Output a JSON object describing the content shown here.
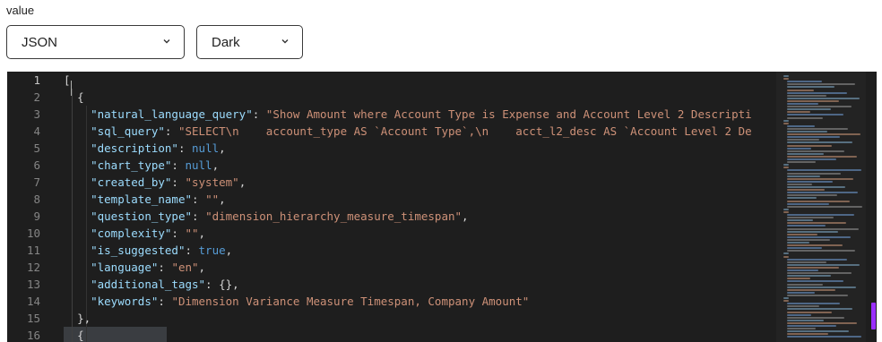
{
  "field": {
    "label": "value"
  },
  "format_select": {
    "value": "JSON",
    "icon": "chevron-down-icon"
  },
  "theme_select": {
    "value": "Dark",
    "icon": "chevron-down-icon"
  },
  "editor": {
    "theme": "dark",
    "colors": {
      "key": "#9cdcfe",
      "string": "#ce9178",
      "constant": "#569cd6",
      "punct": "#d4d4d4",
      "scroll_thumb": "#9b30ff"
    },
    "line_numbers": [
      "1",
      "2",
      "3",
      "4",
      "5",
      "6",
      "7",
      "8",
      "9",
      "10",
      "11",
      "12",
      "13",
      "14",
      "15",
      "16"
    ],
    "lines": [
      {
        "indent": "",
        "tokens": [
          [
            "p",
            "["
          ]
        ]
      },
      {
        "indent": "  ",
        "tokens": [
          [
            "p",
            "{"
          ]
        ]
      },
      {
        "indent": "    ",
        "tokens": [
          [
            "k",
            "\"natural_language_query\""
          ],
          [
            "p",
            ": "
          ],
          [
            "s",
            "\"Show Amount where Account Type is Expense and Account Level 2 Descripti"
          ]
        ]
      },
      {
        "indent": "    ",
        "tokens": [
          [
            "k",
            "\"sql_query\""
          ],
          [
            "p",
            ": "
          ],
          [
            "s",
            "\"SELECT\\n    account_type AS `Account Type`,\\n    acct_l2_desc AS `Account Level 2 De"
          ]
        ]
      },
      {
        "indent": "    ",
        "tokens": [
          [
            "k",
            "\"description\""
          ],
          [
            "p",
            ": "
          ],
          [
            "c",
            "null"
          ],
          [
            "p",
            ","
          ]
        ]
      },
      {
        "indent": "    ",
        "tokens": [
          [
            "k",
            "\"chart_type\""
          ],
          [
            "p",
            ": "
          ],
          [
            "c",
            "null"
          ],
          [
            "p",
            ","
          ]
        ]
      },
      {
        "indent": "    ",
        "tokens": [
          [
            "k",
            "\"created_by\""
          ],
          [
            "p",
            ": "
          ],
          [
            "s",
            "\"system\""
          ],
          [
            "p",
            ","
          ]
        ]
      },
      {
        "indent": "    ",
        "tokens": [
          [
            "k",
            "\"template_name\""
          ],
          [
            "p",
            ": "
          ],
          [
            "s",
            "\"\""
          ],
          [
            "p",
            ","
          ]
        ]
      },
      {
        "indent": "    ",
        "tokens": [
          [
            "k",
            "\"question_type\""
          ],
          [
            "p",
            ": "
          ],
          [
            "s",
            "\"dimension_hierarchy_measure_timespan\""
          ],
          [
            "p",
            ","
          ]
        ]
      },
      {
        "indent": "    ",
        "tokens": [
          [
            "k",
            "\"complexity\""
          ],
          [
            "p",
            ": "
          ],
          [
            "s",
            "\"\""
          ],
          [
            "p",
            ","
          ]
        ]
      },
      {
        "indent": "    ",
        "tokens": [
          [
            "k",
            "\"is_suggested\""
          ],
          [
            "p",
            ": "
          ],
          [
            "c",
            "true"
          ],
          [
            "p",
            ","
          ]
        ]
      },
      {
        "indent": "    ",
        "tokens": [
          [
            "k",
            "\"language\""
          ],
          [
            "p",
            ": "
          ],
          [
            "s",
            "\"en\""
          ],
          [
            "p",
            ","
          ]
        ]
      },
      {
        "indent": "    ",
        "tokens": [
          [
            "k",
            "\"additional_tags\""
          ],
          [
            "p",
            ": {},"
          ]
        ]
      },
      {
        "indent": "    ",
        "tokens": [
          [
            "k",
            "\"keywords\""
          ],
          [
            "p",
            ": "
          ],
          [
            "s",
            "\"Dimension Variance Measure Timespan, Company Amount\""
          ]
        ]
      },
      {
        "indent": "  ",
        "tokens": [
          [
            "p",
            "},"
          ]
        ]
      },
      {
        "indent": "  ",
        "tokens": [
          [
            "p",
            "{"
          ]
        ]
      }
    ]
  }
}
